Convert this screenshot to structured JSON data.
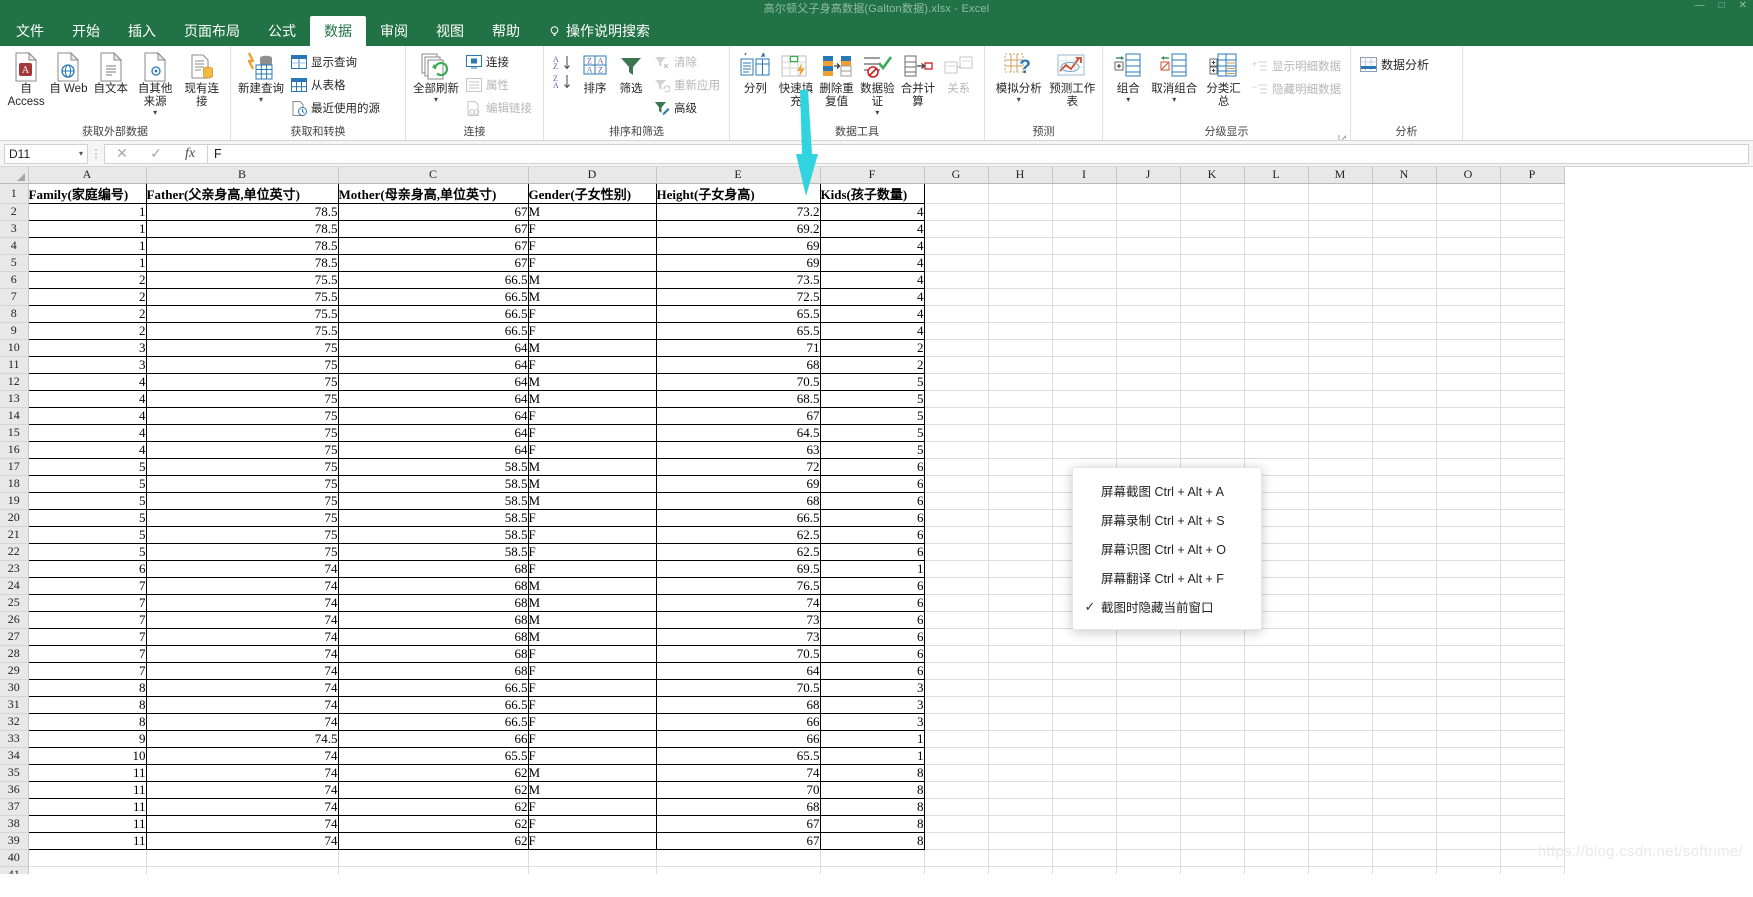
{
  "titlebar": {
    "title": "高尔顿父子身高数据(Galton数据).xlsx - Excel",
    "minimize": "—",
    "maximize": "□",
    "close": "✕"
  },
  "tabs": [
    {
      "label": "文件",
      "active": false
    },
    {
      "label": "开始",
      "active": false
    },
    {
      "label": "插入",
      "active": false
    },
    {
      "label": "页面布局",
      "active": false
    },
    {
      "label": "公式",
      "active": false
    },
    {
      "label": "数据",
      "active": true
    },
    {
      "label": "审阅",
      "active": false
    },
    {
      "label": "视图",
      "active": false
    },
    {
      "label": "帮助",
      "active": false
    }
  ],
  "tell_me": "操作说明搜索",
  "ribbon": {
    "groups": [
      {
        "name": "获取外部数据",
        "big": [
          {
            "label": "自 Access",
            "icon": "access-icon",
            "caret": false
          },
          {
            "label": "自 Web",
            "icon": "web-icon",
            "caret": false
          },
          {
            "label": "自文本",
            "icon": "text-file-icon",
            "caret": false
          },
          {
            "label": "自其他来源",
            "icon": "other-sources-icon",
            "caret": true
          },
          {
            "label": "现有连接",
            "icon": "existing-connection-icon",
            "caret": false
          }
        ],
        "small": []
      },
      {
        "name": "获取和转换",
        "big": [
          {
            "label": "新建查询",
            "icon": "new-query-icon",
            "caret": true
          }
        ],
        "small": [
          {
            "label": "显示查询",
            "icon": "show-queries-icon",
            "dim": false
          },
          {
            "label": "从表格",
            "icon": "from-table-icon",
            "dim": false
          },
          {
            "label": "最近使用的源",
            "icon": "recent-sources-icon",
            "dim": false
          }
        ]
      },
      {
        "name": "连接",
        "big": [
          {
            "label": "全部刷新",
            "icon": "refresh-all-icon",
            "caret": true
          }
        ],
        "small": [
          {
            "label": "连接",
            "icon": "connections-icon",
            "dim": false
          },
          {
            "label": "属性",
            "icon": "properties-icon",
            "dim": true
          },
          {
            "label": "编辑链接",
            "icon": "edit-links-icon",
            "dim": true
          }
        ]
      },
      {
        "name": "排序和筛选",
        "big": [
          {
            "label": "排序",
            "icon": "sort-icon",
            "caret": false
          },
          {
            "label": "筛选",
            "icon": "filter-icon",
            "caret": false
          }
        ],
        "small": [
          {
            "label": "清除",
            "icon": "clear-filter-icon",
            "dim": true
          },
          {
            "label": "重新应用",
            "icon": "reapply-icon",
            "dim": true
          },
          {
            "label": "高级",
            "icon": "advanced-filter-icon",
            "dim": false
          }
        ],
        "sortAZ": "A\nZ",
        "sortZA": "Z\nA"
      },
      {
        "name": "数据工具",
        "big": [
          {
            "label": "分列",
            "icon": "text-to-columns-icon",
            "caret": false
          },
          {
            "label": "快速填充",
            "icon": "flash-fill-icon",
            "caret": false
          },
          {
            "label": "删除重复值",
            "icon": "remove-duplicates-icon",
            "caret": false
          },
          {
            "label": "数据验证",
            "icon": "data-validation-icon",
            "caret": true
          },
          {
            "label": "合并计算",
            "icon": "consolidate-icon",
            "caret": false
          },
          {
            "label": "关系",
            "icon": "relationships-icon",
            "caret": false,
            "dim": true
          }
        ],
        "small": []
      },
      {
        "name": "预测",
        "big": [
          {
            "label": "模拟分析",
            "icon": "what-if-analysis-icon",
            "caret": true
          },
          {
            "label": "预测工作表",
            "icon": "forecast-sheet-icon",
            "caret": false
          }
        ],
        "small": []
      },
      {
        "name": "分级显示",
        "big": [
          {
            "label": "组合",
            "icon": "group-icon",
            "caret": true
          },
          {
            "label": "取消组合",
            "icon": "ungroup-icon",
            "caret": true
          },
          {
            "label": "分类汇总",
            "icon": "subtotal-icon",
            "caret": false
          }
        ],
        "small": [
          {
            "label": "显示明细数据",
            "icon": "show-detail-icon",
            "dim": true
          },
          {
            "label": "隐藏明细数据",
            "icon": "hide-detail-icon",
            "dim": true
          }
        ],
        "dialog_launcher": true
      },
      {
        "name": "分析",
        "big": [],
        "small": [
          {
            "label": "数据分析",
            "icon": "data-analysis-icon",
            "dim": false
          }
        ]
      }
    ]
  },
  "formula_bar": {
    "name_box": "D11",
    "name_box_caret": "▾",
    "cancel": "✕",
    "enter": "✓",
    "function": "fx",
    "value": "F"
  },
  "grid": {
    "column_letters": [
      "A",
      "B",
      "C",
      "D",
      "E",
      "F",
      "G",
      "H",
      "I",
      "J",
      "K",
      "L",
      "M",
      "N",
      "O",
      "P"
    ],
    "headers": [
      "Family(家庭编号)",
      "Father(父亲身高,单位英寸)",
      "Mother(母亲身高,单位英寸)",
      "Gender(子女性别)",
      "Height(子女身高)",
      "Kids(孩子数量)"
    ],
    "rows": [
      [
        1,
        78.5,
        67,
        "M",
        73.2,
        4
      ],
      [
        1,
        78.5,
        67,
        "F",
        69.2,
        4
      ],
      [
        1,
        78.5,
        67,
        "F",
        69,
        4
      ],
      [
        1,
        78.5,
        67,
        "F",
        69,
        4
      ],
      [
        2,
        75.5,
        66.5,
        "M",
        73.5,
        4
      ],
      [
        2,
        75.5,
        66.5,
        "M",
        72.5,
        4
      ],
      [
        2,
        75.5,
        66.5,
        "F",
        65.5,
        4
      ],
      [
        2,
        75.5,
        66.5,
        "F",
        65.5,
        4
      ],
      [
        3,
        75,
        64,
        "M",
        71,
        2
      ],
      [
        3,
        75,
        64,
        "F",
        68,
        2
      ],
      [
        4,
        75,
        64,
        "M",
        70.5,
        5
      ],
      [
        4,
        75,
        64,
        "M",
        68.5,
        5
      ],
      [
        4,
        75,
        64,
        "F",
        67,
        5
      ],
      [
        4,
        75,
        64,
        "F",
        64.5,
        5
      ],
      [
        4,
        75,
        64,
        "F",
        63,
        5
      ],
      [
        5,
        75,
        58.5,
        "M",
        72,
        6
      ],
      [
        5,
        75,
        58.5,
        "M",
        69,
        6
      ],
      [
        5,
        75,
        58.5,
        "M",
        68,
        6
      ],
      [
        5,
        75,
        58.5,
        "F",
        66.5,
        6
      ],
      [
        5,
        75,
        58.5,
        "F",
        62.5,
        6
      ],
      [
        5,
        75,
        58.5,
        "F",
        62.5,
        6
      ],
      [
        6,
        74,
        68,
        "F",
        69.5,
        1
      ],
      [
        7,
        74,
        68,
        "M",
        76.5,
        6
      ],
      [
        7,
        74,
        68,
        "M",
        74,
        6
      ],
      [
        7,
        74,
        68,
        "M",
        73,
        6
      ],
      [
        7,
        74,
        68,
        "M",
        73,
        6
      ],
      [
        7,
        74,
        68,
        "F",
        70.5,
        6
      ],
      [
        7,
        74,
        68,
        "F",
        64,
        6
      ],
      [
        8,
        74,
        66.5,
        "F",
        70.5,
        3
      ],
      [
        8,
        74,
        66.5,
        "F",
        68,
        3
      ],
      [
        8,
        74,
        66.5,
        "F",
        66,
        3
      ],
      [
        9,
        74.5,
        66,
        "F",
        66,
        1
      ],
      [
        10,
        74,
        65.5,
        "F",
        65.5,
        1
      ],
      [
        11,
        74,
        62,
        "M",
        74,
        8
      ],
      [
        11,
        74,
        62,
        "M",
        70,
        8
      ],
      [
        11,
        74,
        62,
        "F",
        68,
        8
      ],
      [
        11,
        74,
        62,
        "F",
        67,
        8
      ],
      [
        11,
        74,
        62,
        "F",
        67,
        8
      ]
    ],
    "row_numbers": [
      1,
      2,
      3,
      4,
      5,
      6,
      7,
      8,
      9,
      10,
      11,
      12,
      13,
      14,
      15,
      16,
      17,
      18,
      19,
      20,
      21,
      22,
      23,
      24,
      25,
      26,
      27,
      28,
      29,
      30,
      31,
      32,
      33,
      34,
      35,
      36,
      37,
      38,
      39
    ],
    "selected_cell": "D11"
  },
  "context_menu": {
    "items": [
      {
        "label": "屏幕截图 Ctrl + Alt + A",
        "checked": false
      },
      {
        "label": "屏幕录制 Ctrl + Alt + S",
        "checked": false
      },
      {
        "label": "屏幕识图 Ctrl + Alt + O",
        "checked": false
      },
      {
        "label": "屏幕翻译 Ctrl + Alt + F",
        "checked": false
      },
      {
        "label": "截图时隐藏当前窗口",
        "checked": true
      }
    ],
    "check_glyph": "✓"
  },
  "annotation": {
    "arrow_color": "#2FD4DE",
    "points_to": "删除重复值"
  },
  "watermark": "https://blog.csdn.net/softrime/",
  "colors": {
    "excel_green": "#217346",
    "accent_arrow": "#2FD4DE",
    "header_gray": "#e8e8e8"
  }
}
